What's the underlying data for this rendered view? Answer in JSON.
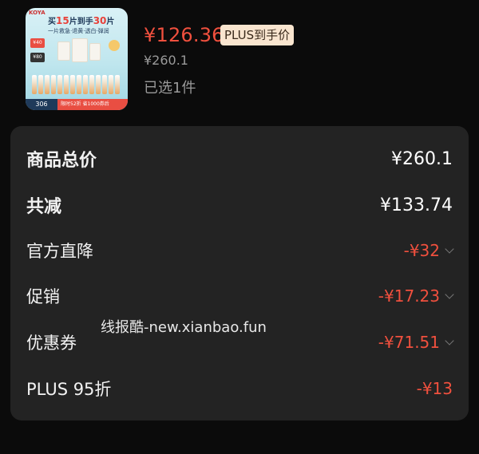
{
  "product": {
    "price": "¥126.36",
    "plus_badge": "PLUS到手价",
    "original_price": "¥260.1",
    "selected": "已选1件",
    "thumb": {
      "brand": "KOYA",
      "headline_pre": "买",
      "headline_n1": "15",
      "headline_mid": "片到手",
      "headline_n2": "30",
      "headline_post": "片",
      "subline": "一片救急·退黄·透白·弹润",
      "tag1": "¥40",
      "tag2": "¥80",
      "price_tag": "306",
      "footer": "限时52折 省1000券后"
    }
  },
  "summary": {
    "rows": [
      {
        "label": "商品总价",
        "value": "¥260.1"
      },
      {
        "label": "共减",
        "value": "¥133.74"
      },
      {
        "label": "官方直降",
        "value": "-¥32"
      },
      {
        "label": "促销",
        "value": "-¥17.23"
      },
      {
        "label": "优惠券",
        "value": "-¥71.51"
      },
      {
        "label": "PLUS 95折",
        "value": "-¥13"
      }
    ]
  },
  "watermark": "线报酷-new.xianbao.fun",
  "colors": {
    "background": "#0b0b0b",
    "card": "#232323",
    "accent_red": "#f0503e",
    "badge_bg": "#f9e5cf"
  }
}
